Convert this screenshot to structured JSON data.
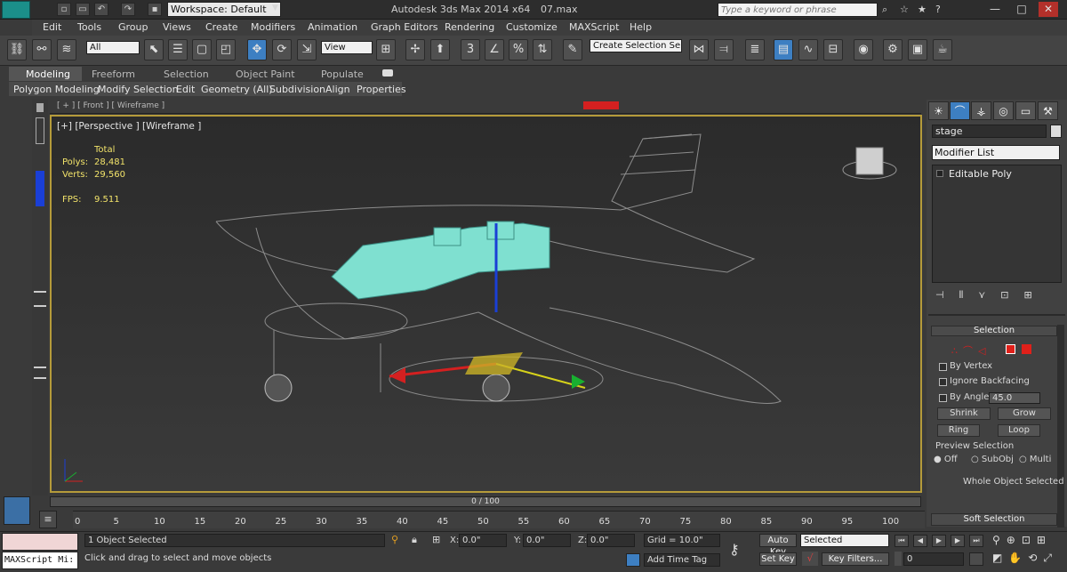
{
  "titlebar": {
    "workspace": "Workspace: Default",
    "app_title": "Autodesk 3ds Max  2014 x64",
    "file_name": "07.max",
    "search_placeholder": "Type a keyword or phrase"
  },
  "menu": [
    "Edit",
    "Tools",
    "Group",
    "Views",
    "Create",
    "Modifiers",
    "Animation",
    "Graph Editors",
    "Rendering",
    "Customize",
    "MAXScript",
    "Help"
  ],
  "toolbar": {
    "selection_filter": "All",
    "ref_coord": "View",
    "selection_set": "Create Selection Se"
  },
  "ribbon": {
    "tabs": [
      "Modeling",
      "Freeform",
      "Selection",
      "Object Paint",
      "Populate"
    ],
    "subtabs": [
      "Polygon Modeling",
      "Modify Selection",
      "Edit",
      "Geometry (All)",
      "Subdivision",
      "Align",
      "Properties"
    ]
  },
  "viewport": {
    "top_label": "[ + ] [ Front ] [ Wireframe ]",
    "label": "[+] [Perspective ] [Wireframe ]",
    "stats": {
      "total_label": "Total",
      "polys_label": "Polys:",
      "polys": "28,481",
      "verts_label": "Verts:",
      "verts": "29,560",
      "fps_label": "FPS:",
      "fps": "9.511"
    }
  },
  "command_panel": {
    "object_name": "stage",
    "modifier_list": "Modifier List",
    "stack_item": "Editable Poly",
    "selection_title": "Selection",
    "by_vertex": "By Vertex",
    "ignore_backfacing": "Ignore Backfacing",
    "by_angle": "By Angle:",
    "angle_value": "45.0",
    "shrink": "Shrink",
    "grow": "Grow",
    "ring": "Ring",
    "loop": "Loop",
    "preview_title": "Preview Selection",
    "preview_options": [
      "Off",
      "SubObj",
      "Multi"
    ],
    "whole_object": "Whole Object Selected",
    "soft_selection": "Soft Selection"
  },
  "timeline": {
    "slider": "0 / 100",
    "ticks": [
      "0",
      "5",
      "10",
      "15",
      "20",
      "25",
      "30",
      "35",
      "40",
      "45",
      "50",
      "55",
      "60",
      "65",
      "70",
      "75",
      "80",
      "85",
      "90",
      "95",
      "100"
    ]
  },
  "status": {
    "maxscript": "MAXScript Mi:",
    "selected": "1 Object Selected",
    "prompt": "Click and drag to select and move objects",
    "x_label": "X:",
    "x": "0.0\"",
    "y_label": "Y:",
    "y": "0.0\"",
    "z_label": "Z:",
    "z": "0.0\"",
    "grid": "Grid = 10.0\"",
    "add_time_tag": "Add Time Tag",
    "auto_key": "Auto Key",
    "set_key": "Set Key",
    "key_mode": "Selected",
    "key_filters": "Key Filters...",
    "frame": "0"
  },
  "colors": {
    "viewport_border": "#b59b3a",
    "engine": "#7fe0d0",
    "stats_text": "#f2e36a",
    "x_axis": "#d42020",
    "y_axis": "#18b030",
    "z_axis": "#1a3fd6"
  }
}
